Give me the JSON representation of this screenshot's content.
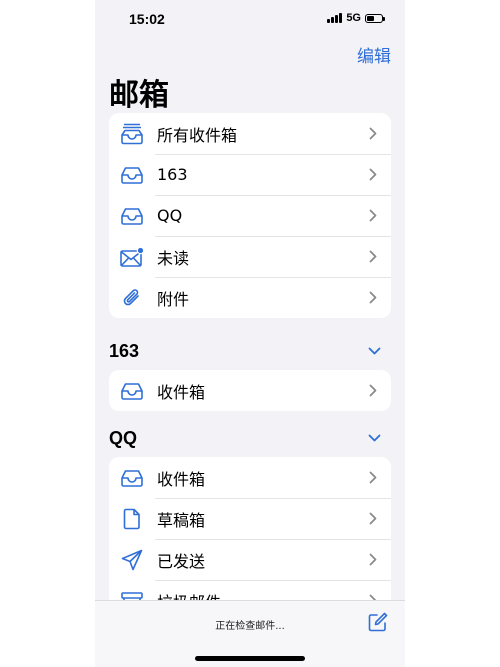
{
  "status_bar": {
    "time": "15:02",
    "network": "5G"
  },
  "nav": {
    "edit_label": "编辑",
    "title": "邮箱"
  },
  "mailboxes": [
    {
      "label": "所有收件箱",
      "icon": "all-inboxes-icon"
    },
    {
      "label": "163",
      "icon": "inbox-icon"
    },
    {
      "label": "QQ",
      "icon": "inbox-icon"
    },
    {
      "label": "未读",
      "icon": "unread-mail-icon"
    },
    {
      "label": "附件",
      "icon": "paperclip-icon"
    }
  ],
  "accounts": [
    {
      "name": "163",
      "folders": [
        {
          "label": "收件箱",
          "icon": "inbox-icon"
        }
      ]
    },
    {
      "name": "QQ",
      "folders": [
        {
          "label": "收件箱",
          "icon": "inbox-icon"
        },
        {
          "label": "草稿箱",
          "icon": "draft-icon"
        },
        {
          "label": "已发送",
          "icon": "sent-icon"
        },
        {
          "label": "垃圾邮件",
          "icon": "junk-icon"
        }
      ]
    }
  ],
  "toolbar": {
    "status_text": "正在检查邮件..."
  },
  "colors": {
    "accent": "#2f6fd6",
    "background": "#f2f2f7",
    "unread_dot": "#2f6fd6"
  }
}
